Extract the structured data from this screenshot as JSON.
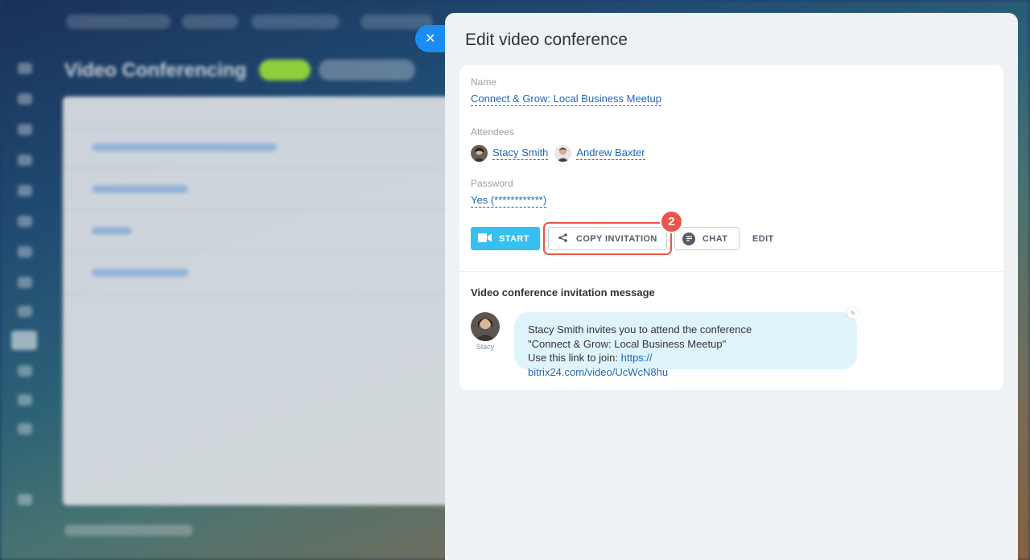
{
  "background": {
    "page_title": "Video Conferencing"
  },
  "slider": {
    "title": "Edit video conference",
    "close_icon": "close-icon"
  },
  "details": {
    "name_label": "Name",
    "name_value": "Connect & Grow: Local Business Meetup",
    "attendees_label": "Attendees",
    "attendees": [
      {
        "name": "Stacy Smith"
      },
      {
        "name": "Andrew Baxter"
      }
    ],
    "password_label": "Password",
    "password_value": "Yes (************)"
  },
  "actions": {
    "start_label": "START",
    "copy_label": "COPY INVITATION",
    "chat_label": "CHAT",
    "edit_label": "EDIT",
    "step_badge": "2"
  },
  "invitation": {
    "heading": "Video conference invitation message",
    "sender_name": "Stacy",
    "line1": "Stacy Smith invites you to attend the conference",
    "line2": "\"Connect & Grow: Local Business Meetup\"",
    "line3_prefix": "Use this link to join: ",
    "url_start": "https://",
    "url_end": "bitrix24.com/video/UcWcN8hu"
  },
  "colors": {
    "accent": "#36c0f0",
    "link": "#1b66b8",
    "highlight": "#e8554a",
    "close_button": "#1b8cf2"
  }
}
